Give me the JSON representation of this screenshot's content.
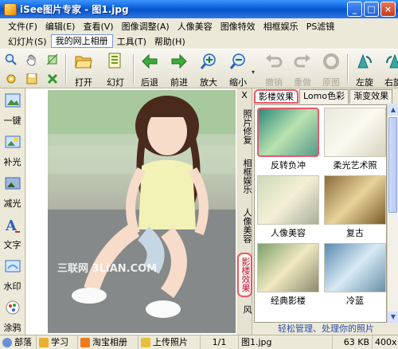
{
  "window": {
    "title": "iSee图片专家 - 图1.jpg",
    "minimize": "_",
    "maximize": "□",
    "close": "×"
  },
  "menu": {
    "row1": [
      "文件(F)",
      "编辑(E)",
      "查看(V)",
      "图像调整(A)",
      "人像美容",
      "图像特效",
      "相框娱乐",
      "PS滤镜"
    ],
    "row2": [
      "幻灯片(S)",
      "我的网上相册",
      "工具(T)",
      "帮助(H)"
    ]
  },
  "toolbar": {
    "buttons": [
      {
        "label": "打开",
        "icon": "folder-open-icon",
        "disabled": false
      },
      {
        "label": "幻灯",
        "icon": "slideshow-icon",
        "disabled": false
      },
      {
        "label": "后退",
        "icon": "arrow-left-icon",
        "disabled": false
      },
      {
        "label": "前进",
        "icon": "arrow-right-icon",
        "disabled": false
      },
      {
        "label": "放大",
        "icon": "zoom-in-icon",
        "disabled": false
      },
      {
        "label": "缩小",
        "icon": "zoom-out-icon",
        "disabled": false
      },
      {
        "label": "撤销",
        "icon": "undo-icon",
        "disabled": true
      },
      {
        "label": "重做",
        "icon": "redo-icon",
        "disabled": true
      },
      {
        "label": "原图",
        "icon": "original-icon",
        "disabled": true
      },
      {
        "label": "左旋",
        "icon": "rotate-left-icon",
        "disabled": false
      },
      {
        "label": "右旋",
        "icon": "rotate-right-icon",
        "disabled": false
      }
    ]
  },
  "left_tools": [
    "一键",
    "补光",
    "减光",
    "文字",
    "水印",
    "涂鸦"
  ],
  "photo": {
    "watermark": "三联网 3LIAN.COM"
  },
  "panel": {
    "close_label": "X",
    "vtabs": [
      "照片修复",
      "相框娱乐",
      "人像美容",
      "影楼效果",
      "风"
    ],
    "active_vtab": 3,
    "htabs": [
      "影楼效果",
      "Lomo色彩",
      "渐变效果"
    ],
    "active_htab": 0,
    "effects": [
      "反转负冲",
      "柔光艺术照",
      "人像美容",
      "复古",
      "经典影楼",
      "冷蓝"
    ],
    "selected_effect": 0,
    "footer": "轻松管理、处理你的照片"
  },
  "status": {
    "items": [
      "部落",
      "学习",
      "淘宝相册",
      "上传照片",
      "1/1",
      "图1.jpg",
      "63 KB",
      "400x"
    ]
  },
  "colors": {
    "accent_red": "#e45a6f",
    "title_blue": "#0a5fd8",
    "link_blue": "#2d4fa8"
  }
}
